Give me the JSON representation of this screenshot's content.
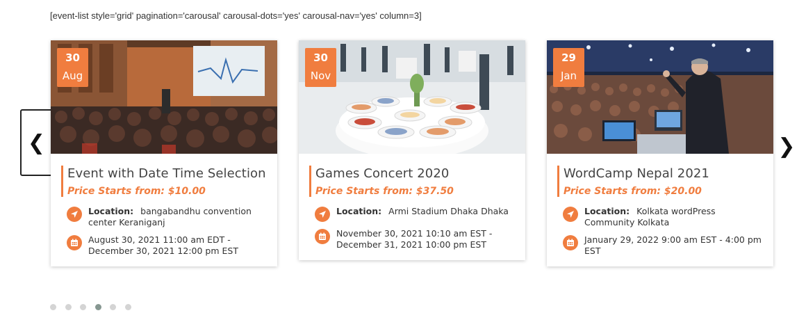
{
  "shortcode": "[event-list style='grid' pagination='carousal' carousal-dots='yes' carousal-nav='yes' column=3]",
  "nav": {
    "prev_glyph": "❮",
    "next_glyph": "❯"
  },
  "location_label": "Location:",
  "events": [
    {
      "day": "30",
      "month": "Aug",
      "title": "Event with Date Time Selection",
      "price": "Price Starts from: $10.00",
      "location": "bangabandhu convention center Keraniganj",
      "datetime": "August 30, 2021  11:00 am EDT - December 30, 2021 12:00 pm EST",
      "image": "conference-presentation"
    },
    {
      "day": "30",
      "month": "Nov",
      "title": "Games Concert 2020",
      "price": "Price Starts from: $37.50",
      "location": "Armi Stadium Dhaka Dhaka",
      "datetime": "November 30, 2021  10:10 am EST - December 31, 2021 10:00 pm EST",
      "image": "catering-table"
    },
    {
      "day": "29",
      "month": "Jan",
      "title": "WordCamp Nepal 2021",
      "price": "Price Starts from: $20.00",
      "location": "Kolkata wordPress Community Kolkata",
      "datetime": "January 29, 2022  9:00 am EST - 4:00 pm EST",
      "image": "speaker-audience"
    }
  ],
  "dots": {
    "count": 6,
    "active_index": 3
  },
  "colors": {
    "accent": "#f07d3f",
    "dot": "#d4d4d4",
    "dot_active": "#869791"
  }
}
